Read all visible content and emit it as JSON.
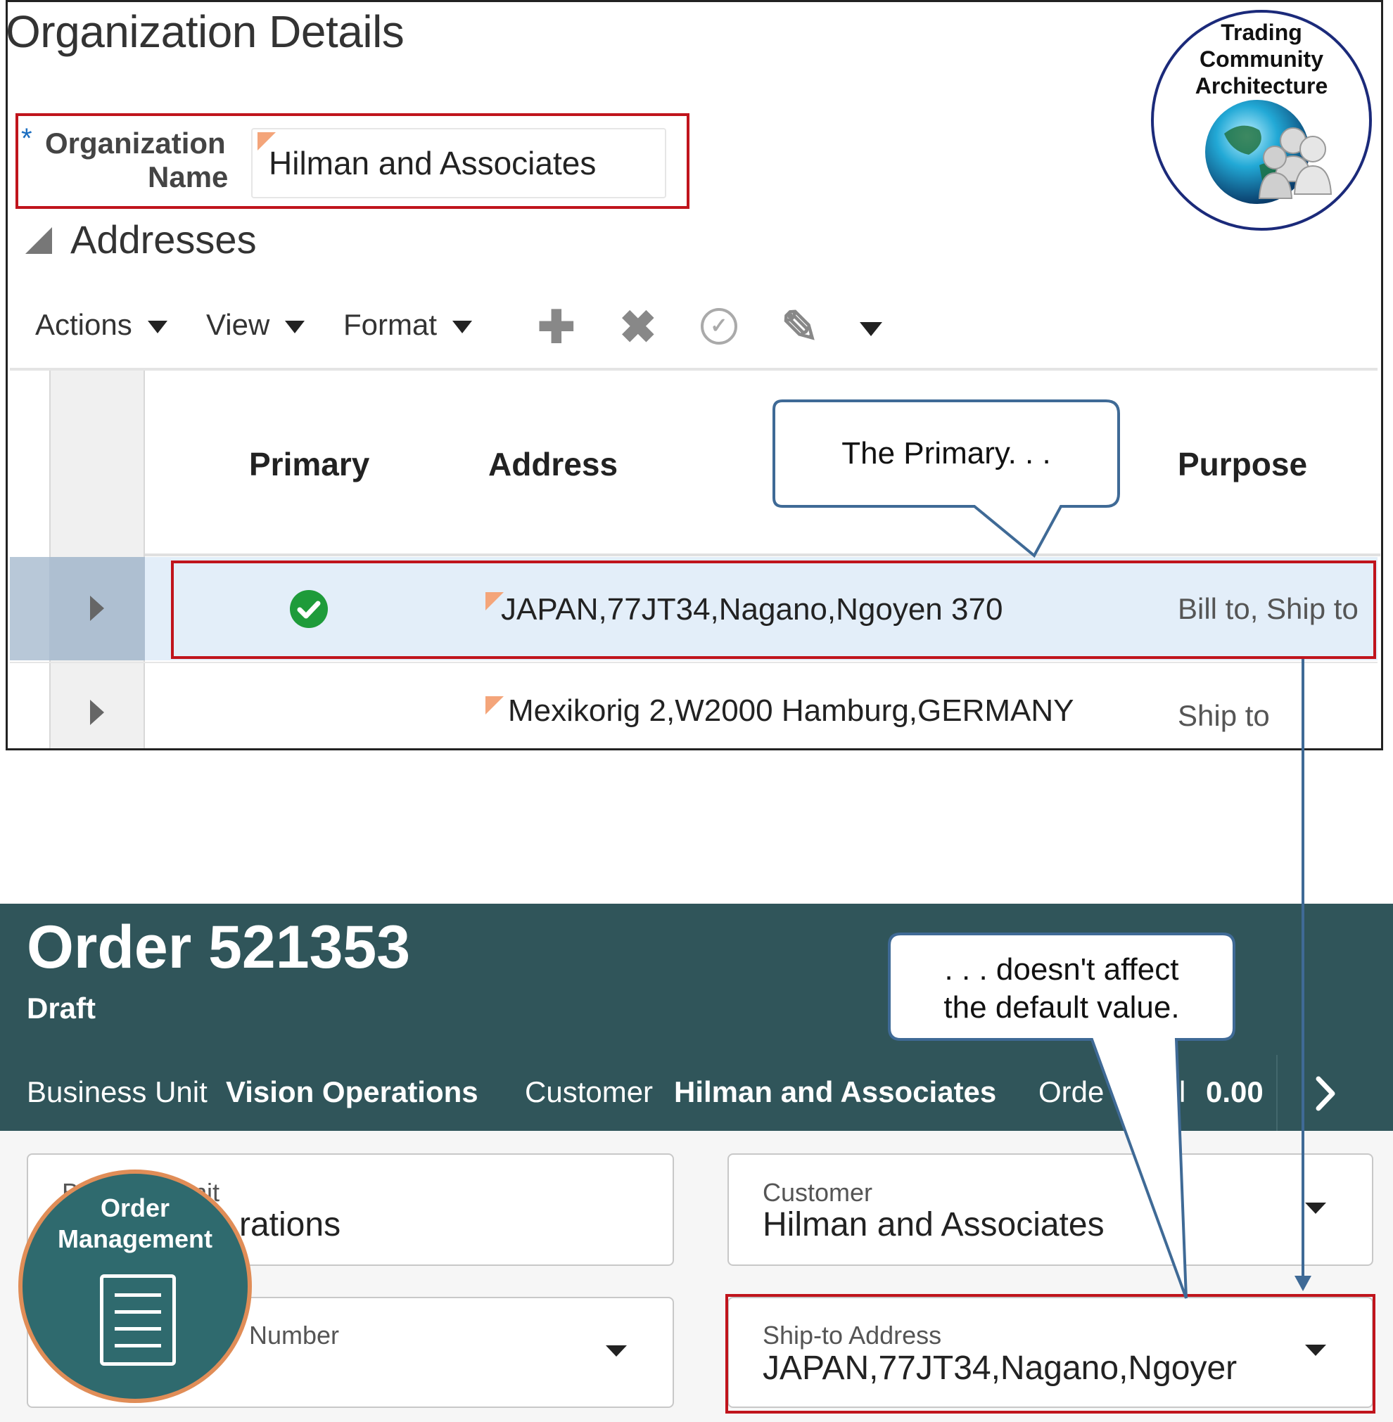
{
  "org_details": {
    "title": "Organization Details",
    "required_marker": "*",
    "org_name_label_1": "Organization",
    "org_name_label_2": "Name",
    "org_name_value": "Hilman and Associates"
  },
  "addresses": {
    "title": "Addresses",
    "toolbar": {
      "actions_label": "Actions",
      "view_label": "View",
      "format_label": "Format",
      "icons": [
        "add-icon",
        "delete-icon",
        "check-circle-icon",
        "edit-icon",
        "more-dropdown-icon"
      ]
    },
    "columns": [
      "Primary",
      "Address",
      "Purpose"
    ],
    "rows": [
      {
        "primary": true,
        "address": "JAPAN,77JT34,Nagano,Ngoyen 370",
        "purpose": "Bill to, Ship to",
        "selected": true
      },
      {
        "primary": false,
        "address": "Mexikorig 2,W2000 Hamburg,GERMANY",
        "purpose": "Ship to",
        "selected": false
      }
    ]
  },
  "callouts": {
    "top": "The Primary. . .",
    "bottom_line1": ". . . doesn't affect",
    "bottom_line2": "the default value."
  },
  "tca_badge": {
    "line1": "Trading",
    "line2": "Community",
    "line3": "Architecture",
    "icon": "globe-people-icon"
  },
  "order": {
    "title": "Order 521353",
    "status": "Draft",
    "business_unit_label": "Business Unit",
    "business_unit_value": "Vision Operations",
    "customer_label": "Customer",
    "customer_value": "Hilman and Associates",
    "order_total_label_visible": "Orde",
    "order_total_label_end": "l",
    "order_total_value": "0.00",
    "fields": {
      "business_unit_label_visible_start": "B",
      "business_unit_label_visible_end": "nit",
      "business_unit_value_visible": "rations",
      "customer_label": "Customer",
      "customer_value": "Hilman and Associates",
      "po_label_visible": "Number",
      "ship_to_label": "Ship-to Address",
      "ship_to_value": "JAPAN,77JT34,Nagano,Ngoyer"
    }
  },
  "om_badge": {
    "line1": "Order",
    "line2": "Management",
    "icon": "document-icon"
  },
  "colors": {
    "highlight_red": "#c0141c",
    "header_teal": "#30555a",
    "callout_border": "#3f6a96",
    "om_badge_bg": "#2f6a6e",
    "om_badge_ring": "#e08d57",
    "primary_check_green": "#1e9b3a"
  }
}
